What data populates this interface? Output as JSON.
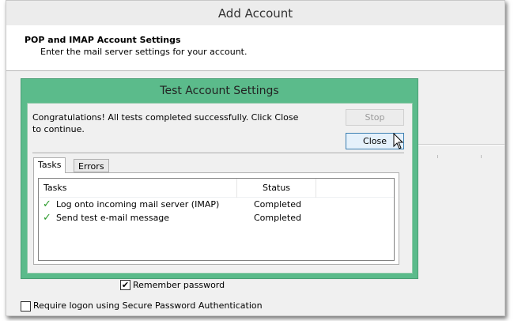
{
  "window": {
    "title": "Add Account"
  },
  "header": {
    "title": "POP and IMAP Account Settings",
    "subtitle": "Enter the mail server settings for your account."
  },
  "dialog": {
    "title": "Test Account Settings",
    "message": "Congratulations! All tests completed successfully. Click Close to continue.",
    "stop_label": "Stop",
    "close_label": "Close",
    "tabs": [
      {
        "label": "Tasks",
        "active": true
      },
      {
        "label": "Errors",
        "active": false
      }
    ],
    "columns": [
      "Tasks",
      "Status"
    ],
    "rows": [
      {
        "task": "Log onto incoming mail server (IMAP)",
        "status": "Completed"
      },
      {
        "task": "Send test e-mail message",
        "status": "Completed"
      }
    ]
  },
  "options": {
    "remember_password": {
      "label": "Remember password",
      "checked": true
    },
    "spa": {
      "label": "Require logon using Secure Password Authentication",
      "checked": false
    }
  },
  "colors": {
    "dialog_border": "#5bbb8b"
  }
}
